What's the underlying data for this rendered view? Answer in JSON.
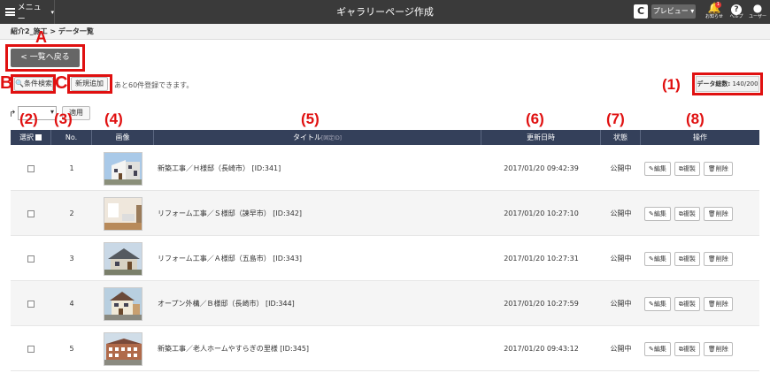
{
  "topbar": {
    "menu_label": "メニュー",
    "title": "ギャラリーページ作成",
    "refresh_label": "C",
    "preview_label": "プレビュー ▾",
    "notifications_label": "お知らせ",
    "notifications_count": "1",
    "help_label": "ヘルプ",
    "user_label": "ユーザー"
  },
  "breadcrumb": "紹介2_施工 > データ一覧",
  "back_button": "< 一覧へ戻る",
  "search_button": "条件検索",
  "add_button": "新規追加",
  "info_text": "あと60件登録できます。",
  "data_count": {
    "label": "データ総数:",
    "value": "140/200"
  },
  "apply_button": "適用",
  "annotations": {
    "A": "A",
    "B": "B",
    "C": "C",
    "n1": "(1)",
    "n2": "(2)",
    "n3": "(3)",
    "n4": "(4)",
    "n5": "(5)",
    "n6": "(6)",
    "n7": "(7)",
    "n8": "(8)"
  },
  "table": {
    "headers": {
      "select": "選択",
      "no": "No.",
      "image": "画像",
      "title": "タイトル",
      "title_sub": "[固定ID]",
      "updated": "更新日時",
      "status": "状態",
      "actions": "操作"
    },
    "rows": [
      {
        "no": "1",
        "title": "新築工事／Ｈ様邸（長崎市） [ID:341]",
        "updated": "2017/01/20 09:42:39",
        "status": "公開中",
        "image": "house-modern-white"
      },
      {
        "no": "2",
        "title": "リフォーム工事／Ｓ様邸（諫早市） [ID:342]",
        "updated": "2017/01/20 10:27:10",
        "status": "公開中",
        "image": "interior-room"
      },
      {
        "no": "3",
        "title": "リフォーム工事／Ａ様邸（五島市） [ID:343]",
        "updated": "2017/01/20 10:27:31",
        "status": "公開中",
        "image": "house-gray-roof"
      },
      {
        "no": "4",
        "title": "オープン外構／Ｂ様邸（長崎市） [ID:344]",
        "updated": "2017/01/20 10:27:59",
        "status": "公開中",
        "image": "house-two-story"
      },
      {
        "no": "5",
        "title": "新築工事／老人ホームやすらぎの里様 [ID:345]",
        "updated": "2017/01/20 09:43:12",
        "status": "公開中",
        "image": "nursing-home"
      }
    ],
    "action_labels": {
      "edit": "編集",
      "copy": "複製",
      "delete": "削除"
    }
  }
}
